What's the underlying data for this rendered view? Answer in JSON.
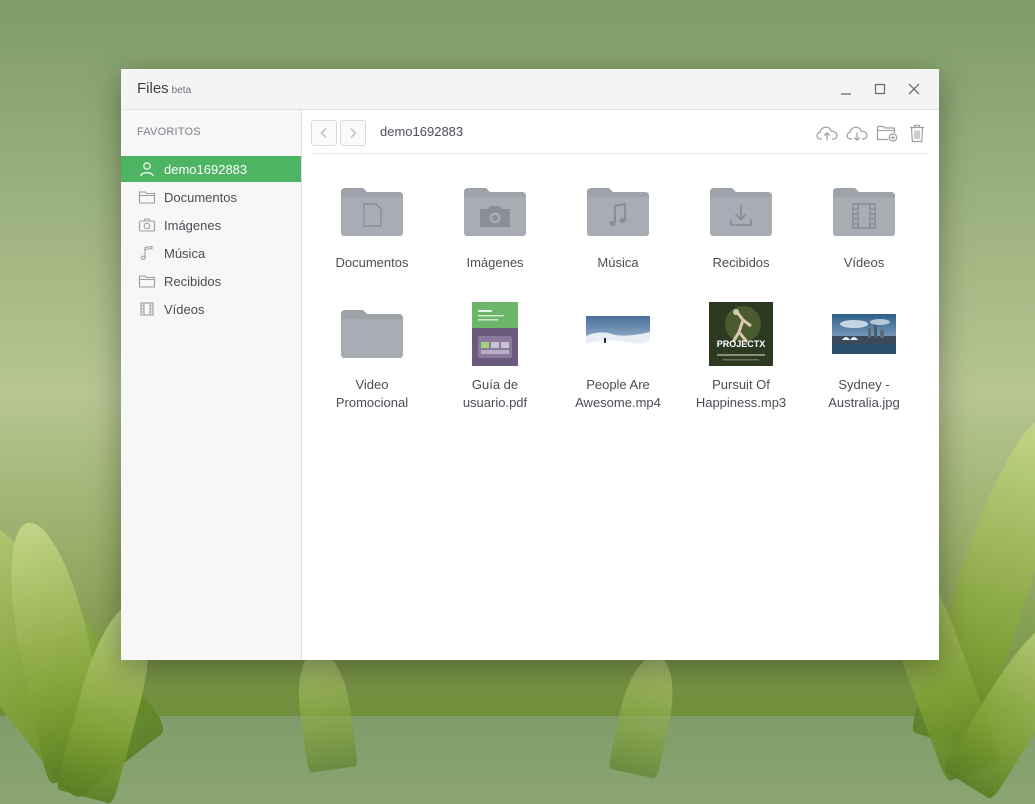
{
  "window": {
    "app_title": "Files",
    "app_badge": "beta",
    "controls": [
      "minimize-icon",
      "maximize-icon",
      "close-icon"
    ]
  },
  "sidebar": {
    "heading": "FAVORITOS",
    "items": [
      {
        "label": "demo1692883",
        "icon": "user-icon",
        "active": true
      },
      {
        "label": "Documentos",
        "icon": "folder-icon"
      },
      {
        "label": "Imágenes",
        "icon": "camera-icon"
      },
      {
        "label": "Música",
        "icon": "music-note-icon"
      },
      {
        "label": "Recibidos",
        "icon": "folder-icon"
      },
      {
        "label": "Vídeos",
        "icon": "film-icon"
      }
    ]
  },
  "toolbar": {
    "path": "demo1692883",
    "actions": [
      "upload-icon",
      "download-icon",
      "new-folder-icon",
      "trash-icon"
    ]
  },
  "files": [
    {
      "line1": "Documentos",
      "line2": "",
      "type": "folder",
      "glyph": "document-icon"
    },
    {
      "line1": "Imágenes",
      "line2": "",
      "type": "folder",
      "glyph": "camera-icon"
    },
    {
      "line1": "Música",
      "line2": "",
      "type": "folder",
      "glyph": "music-note-icon"
    },
    {
      "line1": "Recibidos",
      "line2": "",
      "type": "folder",
      "glyph": "download-tray-icon"
    },
    {
      "line1": "Vídeos",
      "line2": "",
      "type": "folder",
      "glyph": "film-icon"
    },
    {
      "line1": "Video",
      "line2": "Promocional",
      "type": "folder",
      "glyph": ""
    },
    {
      "line1": "Guía de",
      "line2": "usuario.pdf",
      "type": "pdf-thumbnail"
    },
    {
      "line1": "People Are",
      "line2": "Awesome.mp4",
      "type": "video-thumbnail"
    },
    {
      "line1": "Pursuit Of",
      "line2": "Happiness.mp3",
      "type": "album-cover",
      "cover_text": "PROJECTX"
    },
    {
      "line1": "Sydney -",
      "line2": "Australia.jpg",
      "type": "image-thumbnail"
    }
  ],
  "colors": {
    "accent": "#4cb462",
    "folder": "#a3a8ae",
    "icon": "#9a9fa6"
  }
}
